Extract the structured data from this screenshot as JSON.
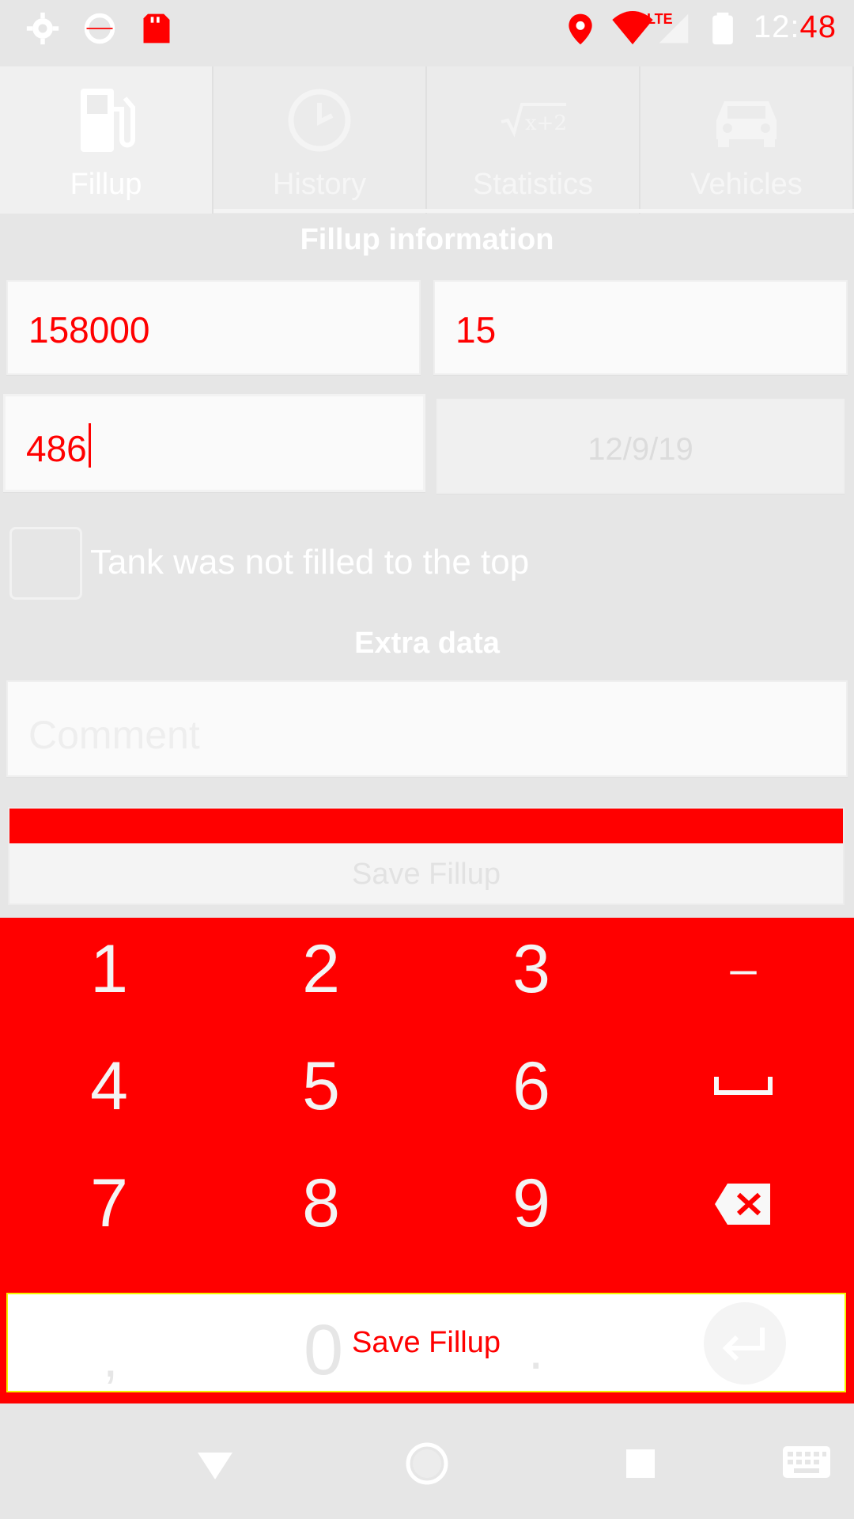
{
  "status_bar": {
    "time_prefix": "12:",
    "time_suffix": "48",
    "network_label": "LTE",
    "icons": [
      "gear-icon",
      "sync-icon",
      "sd-card-icon",
      "location-icon",
      "wifi-icon",
      "cell-signal-icon",
      "battery-icon"
    ]
  },
  "tabs": [
    {
      "label": "Fillup",
      "icon": "fuel-pump-icon",
      "active": true
    },
    {
      "label": "History",
      "icon": "clock-icon",
      "active": false
    },
    {
      "label": "Statistics",
      "icon": "sqrt-formula-icon",
      "active": false
    },
    {
      "label": "Vehicles",
      "icon": "car-icon",
      "active": false
    }
  ],
  "form": {
    "section_title": "Fillup information",
    "odometer_value": "158000",
    "volume_value": "15",
    "price_value": "486",
    "date_value": "12/9/19",
    "checkbox_label": "Tank was not filled to the top",
    "checkbox_checked": false,
    "extra_title": "Extra data",
    "comment_placeholder": "Comment",
    "save_label": "Save Fillup"
  },
  "keypad": {
    "keys": [
      "1",
      "2",
      "3",
      "–",
      "4",
      "5",
      "6",
      "␣",
      "7",
      "8",
      "9",
      "⌫",
      ",",
      "0",
      ".",
      "↵"
    ],
    "save_label": "Save Fillup"
  },
  "nav_bar": {
    "icons": [
      "back-icon",
      "home-icon",
      "recents-icon",
      "keyboard-icon"
    ]
  },
  "colors": {
    "accent": "#ff0000",
    "background": "#e6e6e6"
  }
}
